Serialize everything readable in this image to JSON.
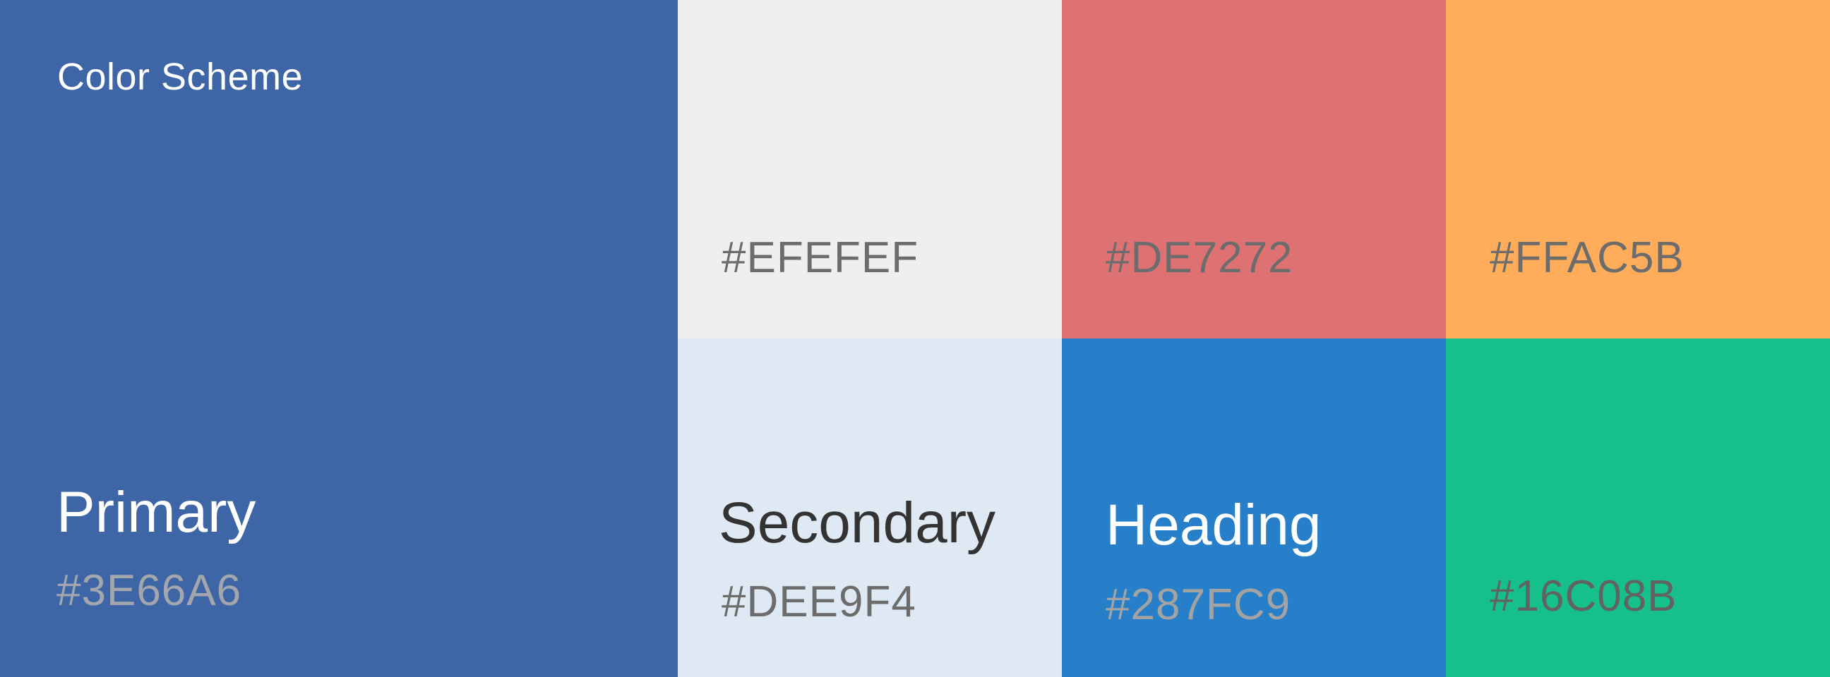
{
  "title": "Color Scheme",
  "swatches": {
    "primary": {
      "name": "Primary",
      "hex": "#3E66A6",
      "color": "#3E66A6"
    },
    "light": {
      "hex": "#EFEFEF",
      "color": "#EFEFEF",
      "text_color": "#6C6C6C"
    },
    "red": {
      "hex": "#DE7272",
      "color": "#DE7272",
      "text_color": "#6C6C6C"
    },
    "orange": {
      "hex": "#FFAC5B",
      "color": "#FFAC5B",
      "text_color": "#6C6C6C"
    },
    "secondary": {
      "name": "Secondary",
      "hex": "#DEE9F4",
      "color": "#DEE9F4"
    },
    "heading": {
      "name": "Heading",
      "hex": "#287FC9",
      "color": "#287FC9"
    },
    "green": {
      "hex": "#16C08B",
      "color": "#16C08B"
    }
  }
}
